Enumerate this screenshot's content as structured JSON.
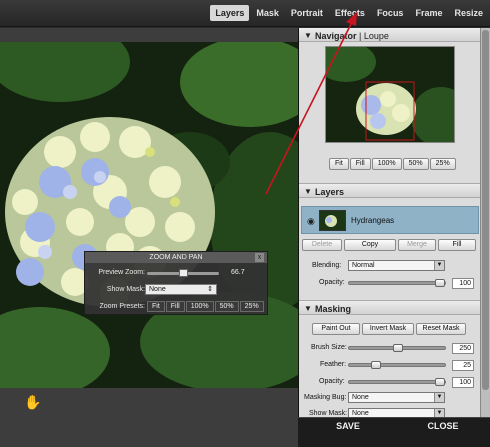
{
  "top_tabs": [
    "Layers",
    "Mask",
    "Portrait",
    "Effects",
    "Focus",
    "Frame",
    "Resize"
  ],
  "active_tab": "Layers",
  "zoom_pan": {
    "title": "ZOOM AND PAN",
    "close_glyph": "x",
    "preview_zoom_label": "Preview Zoom:",
    "preview_zoom_value": "66.7",
    "show_mask_label": "Show Mask:",
    "show_mask_value": "None",
    "zoom_presets_label": "Zoom Presets:",
    "presets": [
      "Fit",
      "Fill",
      "100%",
      "50%",
      "25%"
    ]
  },
  "navigator": {
    "title": "Navigator",
    "separator": "|",
    "loupe": "Loupe",
    "buttons": [
      "Fit",
      "Fill",
      "100%",
      "50%",
      "25%"
    ]
  },
  "layers": {
    "title": "Layers",
    "layer_name": "Hydrangeas",
    "actions": [
      "Delete",
      "Copy",
      "Merge",
      "Fill"
    ],
    "blending_label": "Blending:",
    "blending_value": "Normal",
    "opacity_label": "Opacity:",
    "opacity_value": "100"
  },
  "masking": {
    "title": "Masking",
    "actions": [
      "Paint Out",
      "Invert Mask",
      "Reset Mask"
    ],
    "brush_size_label": "Brush Size:",
    "brush_size_value": "250",
    "feather_label": "Feather:",
    "feather_value": "25",
    "opacity_label": "Opacity:",
    "opacity_value": "100",
    "masking_bug_label": "Masking Bug:",
    "masking_bug_value": "None",
    "show_mask_label": "Show Mask:",
    "show_mask_value": "None"
  },
  "bottom": {
    "save": "SAVE",
    "close": "CLOSE"
  },
  "colors": {
    "annotation_arrow": "#c8141e",
    "layer_selected": "#8fb2c6"
  }
}
